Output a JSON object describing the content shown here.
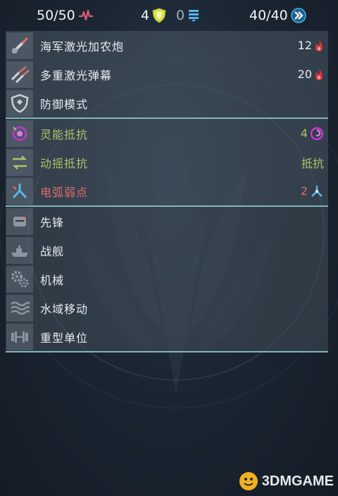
{
  "topbar": {
    "hp": "50/50",
    "shield": "4",
    "armor": "0",
    "energy": "40/40"
  },
  "weapons": [
    {
      "label": "海军激光加农炮",
      "value": "12",
      "icon": "laser-cannon-icon",
      "value_icon": "flame-icon"
    },
    {
      "label": "多重激光弹幕",
      "value": "20",
      "icon": "laser-barrage-icon",
      "value_icon": "flame-icon"
    },
    {
      "label": "防御模式",
      "value": "",
      "icon": "shield-mode-icon",
      "value_icon": ""
    }
  ],
  "resistances": [
    {
      "label": "灵能抵抗",
      "value": "4",
      "icon": "psionic-icon",
      "value_icon": "psionic-swirl-icon",
      "color": "#a9c56a"
    },
    {
      "label": "动摇抵抗",
      "value": "抵抗",
      "icon": "waver-icon",
      "value_icon": "",
      "color": "#a9c56a"
    },
    {
      "label": "电弧弱点",
      "value": "2",
      "icon": "arc-icon",
      "value_icon": "arc-triad-icon",
      "color": "#e06c6c"
    }
  ],
  "traits": [
    {
      "label": "先锋",
      "icon": "vanguard-icon"
    },
    {
      "label": "战舰",
      "icon": "warship-icon"
    },
    {
      "label": "机械",
      "icon": "gears-icon"
    },
    {
      "label": "水域移动",
      "icon": "waves-icon"
    },
    {
      "label": "重型单位",
      "icon": "dumbbell-icon"
    }
  ],
  "watermark": "3DMGAME",
  "colors": {
    "resist": "#a9c56a",
    "weak": "#e06c6c",
    "flame": "#d8343a",
    "heart": "#e05a78",
    "shield": "#d9e14a",
    "armor": "#5ab4e8",
    "energy": "#46b0e8"
  }
}
